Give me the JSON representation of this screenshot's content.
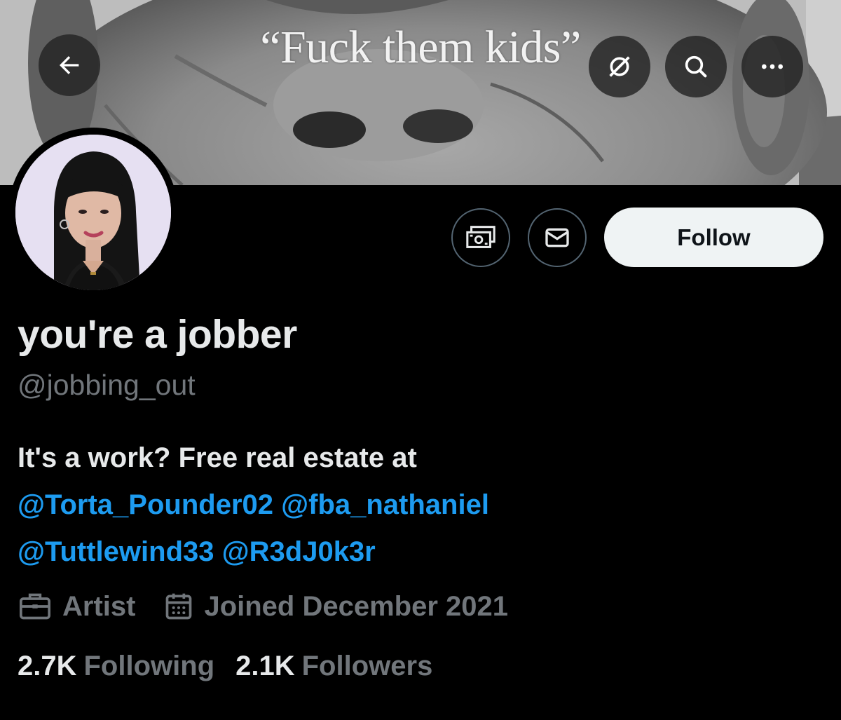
{
  "banner": {
    "caption": "“Fuck them kids”"
  },
  "nav": {
    "back_icon": "arrow-left-icon",
    "grok_icon": "slash-circle-icon",
    "search_icon": "search-icon",
    "more_icon": "more-horizontal-icon"
  },
  "actions": {
    "tip_icon": "money-icon",
    "message_icon": "envelope-icon",
    "follow_label": "Follow"
  },
  "profile": {
    "display_name": "you're a jobber",
    "handle": "@jobbing_out",
    "bio_text": "It's a work? Free real estate at",
    "bio_mentions": [
      "@Torta_Pounder02",
      "@fba_nathaniel",
      "@Tuttlewind33",
      "@R3dJ0k3r"
    ],
    "profession": "Artist",
    "joined": "Joined December 2021",
    "following_count": "2.7K",
    "following_label": "Following",
    "followers_count": "2.1K",
    "followers_label": "Followers"
  },
  "colors": {
    "background": "#000000",
    "text_primary": "#e7e9ea",
    "text_secondary": "#71767b",
    "link": "#1d9bf0",
    "follow_bg": "#eff3f4"
  }
}
